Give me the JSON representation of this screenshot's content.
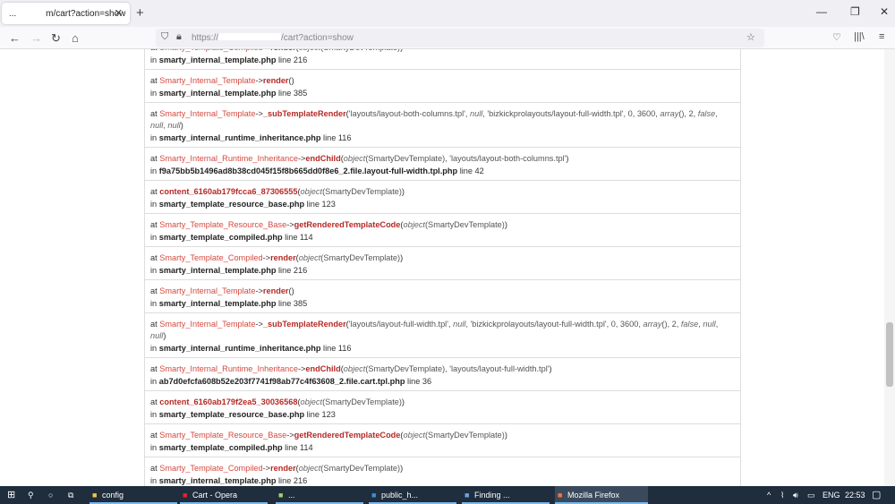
{
  "browser": {
    "tab_title": "m/cart?action=show",
    "tab_prefix": "...",
    "url_prefix": "https://",
    "url_suffix": "/cart?action=show"
  },
  "frames": [
    {
      "cls": "Smarty_Template_Compiled",
      "arrow": "->",
      "method": "render",
      "args": [
        {
          "t": "object",
          "s": "em"
        },
        {
          "t": "(SmartyDevTemplate)",
          "s": "str"
        }
      ],
      "file": "smarty_internal_template.php",
      "line": "line 216"
    },
    {
      "cls": "Smarty_Internal_Template",
      "arrow": "->",
      "method": "render",
      "args": [],
      "file": "smarty_internal_template.php",
      "line": "line 385"
    },
    {
      "cls": "Smarty_Internal_Template",
      "arrow": "->",
      "method": "_subTemplateRender",
      "args": [
        {
          "t": "'layouts/layout-both-columns.tpl', ",
          "s": "str"
        },
        {
          "t": "null",
          "s": "em"
        },
        {
          "t": ", 'bizkickprolayouts/layout-full-width.tpl', 0, 3600, ",
          "s": "str"
        },
        {
          "t": "array",
          "s": "em"
        },
        {
          "t": "(), 2, ",
          "s": "str"
        },
        {
          "t": "false",
          "s": "em"
        },
        {
          "t": ", ",
          "s": "str"
        },
        {
          "t": "null",
          "s": "em"
        },
        {
          "t": ", ",
          "s": "str"
        },
        {
          "t": "null",
          "s": "em"
        }
      ],
      "file": "smarty_internal_runtime_inheritance.php",
      "line": "line 116"
    },
    {
      "cls": "Smarty_Internal_Runtime_Inheritance",
      "arrow": "->",
      "method": "endChild",
      "args": [
        {
          "t": "object",
          "s": "em"
        },
        {
          "t": "(SmartyDevTemplate), 'layouts/layout-both-columns.tpl'",
          "s": "str"
        }
      ],
      "file": "f9a75bb5b1496ad8b38cd045f15f8b665dd0f8e6_2.file.layout-full-width.tpl.php",
      "line": "line 42"
    },
    {
      "cls": "",
      "arrow": "",
      "method": "content_6160ab179fcca6_87306555",
      "args": [
        {
          "t": "object",
          "s": "em"
        },
        {
          "t": "(SmartyDevTemplate)",
          "s": "str"
        }
      ],
      "file": "smarty_template_resource_base.php",
      "line": "line 123"
    },
    {
      "cls": "Smarty_Template_Resource_Base",
      "arrow": "->",
      "method": "getRenderedTemplateCode",
      "args": [
        {
          "t": "object",
          "s": "em"
        },
        {
          "t": "(SmartyDevTemplate)",
          "s": "str"
        }
      ],
      "file": "smarty_template_compiled.php",
      "line": "line 114"
    },
    {
      "cls": "Smarty_Template_Compiled",
      "arrow": "->",
      "method": "render",
      "args": [
        {
          "t": "object",
          "s": "em"
        },
        {
          "t": "(SmartyDevTemplate)",
          "s": "str"
        }
      ],
      "file": "smarty_internal_template.php",
      "line": "line 216"
    },
    {
      "cls": "Smarty_Internal_Template",
      "arrow": "->",
      "method": "render",
      "args": [],
      "file": "smarty_internal_template.php",
      "line": "line 385"
    },
    {
      "cls": "Smarty_Internal_Template",
      "arrow": "->",
      "method": "_subTemplateRender",
      "args": [
        {
          "t": "'layouts/layout-full-width.tpl', ",
          "s": "str"
        },
        {
          "t": "null",
          "s": "em"
        },
        {
          "t": ", 'bizkickprolayouts/layout-full-width.tpl', 0, 3600, ",
          "s": "str"
        },
        {
          "t": "array",
          "s": "em"
        },
        {
          "t": "(), 2, ",
          "s": "str"
        },
        {
          "t": "false",
          "s": "em"
        },
        {
          "t": ", ",
          "s": "str"
        },
        {
          "t": "null",
          "s": "em"
        },
        {
          "t": ", ",
          "s": "str"
        },
        {
          "t": "null",
          "s": "em"
        }
      ],
      "file": "smarty_internal_runtime_inheritance.php",
      "line": "line 116"
    },
    {
      "cls": "Smarty_Internal_Runtime_Inheritance",
      "arrow": "->",
      "method": "endChild",
      "args": [
        {
          "t": "object",
          "s": "em"
        },
        {
          "t": "(SmartyDevTemplate), 'layouts/layout-full-width.tpl'",
          "s": "str"
        }
      ],
      "file": "ab7d0efcfa608b52e203f7741f98ab77c4f63608_2.file.cart.tpl.php",
      "line": "line 36"
    },
    {
      "cls": "",
      "arrow": "",
      "method": "content_6160ab179f2ea5_30036568",
      "args": [
        {
          "t": "object",
          "s": "em"
        },
        {
          "t": "(SmartyDevTemplate)",
          "s": "str"
        }
      ],
      "file": "smarty_template_resource_base.php",
      "line": "line 123"
    },
    {
      "cls": "Smarty_Template_Resource_Base",
      "arrow": "->",
      "method": "getRenderedTemplateCode",
      "args": [
        {
          "t": "object",
          "s": "em"
        },
        {
          "t": "(SmartyDevTemplate)",
          "s": "str"
        }
      ],
      "file": "smarty_template_compiled.php",
      "line": "line 114"
    },
    {
      "cls": "Smarty_Template_Compiled",
      "arrow": "->",
      "method": "render",
      "args": [
        {
          "t": "object",
          "s": "em"
        },
        {
          "t": "(SmartyDevTemplate)",
          "s": "str"
        }
      ],
      "file": "smarty_internal_template.php",
      "line": "line 216"
    }
  ],
  "labels": {
    "at": "at ",
    "in": "in "
  },
  "taskbar": {
    "apps": [
      {
        "label": "config",
        "icon": "folder-icon",
        "color": "#f4c542"
      },
      {
        "label": "Cart - Opera",
        "icon": "opera-icon",
        "color": "#e0252c"
      },
      {
        "label": "...",
        "icon": "notepad-icon",
        "color": "#9ed36a"
      },
      {
        "label": "public_h...",
        "icon": "app-icon",
        "color": "#3a8fdd"
      },
      {
        "label": "Finding ...",
        "icon": "document-icon",
        "color": "#6aa5e8"
      },
      {
        "label": "Mozilla Firefox",
        "icon": "firefox-icon",
        "color": "#ff7139"
      }
    ],
    "lang": "ENG",
    "time": "22:53"
  }
}
